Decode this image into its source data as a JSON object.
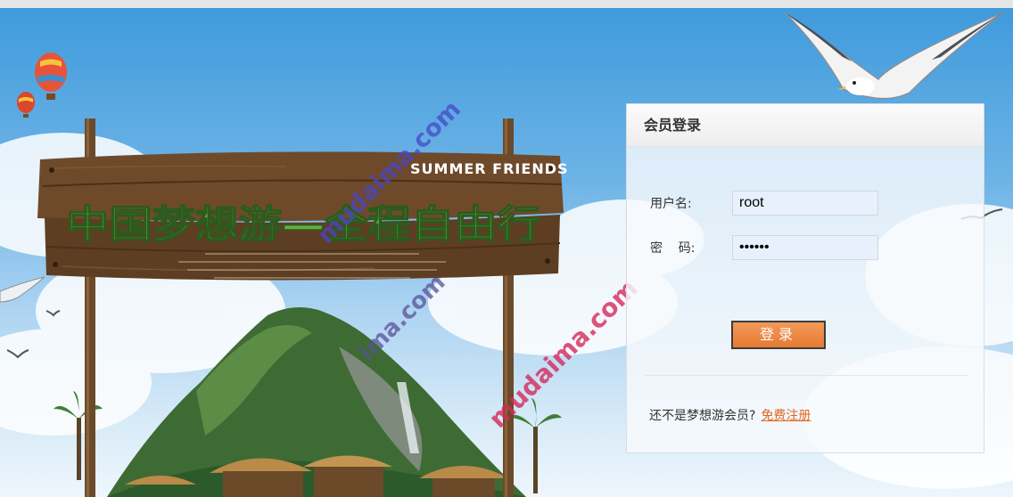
{
  "banner": {
    "title": "中国梦想游—全程自由行",
    "subtitle": "SUMMER FRIENDS"
  },
  "watermark": {
    "text": "mudaima.com",
    "partial_text": "ima.com"
  },
  "login": {
    "title": "会员登录",
    "username_label": "用户名:",
    "username_value": "root",
    "password_label": "密    码:",
    "password_value": "••••••",
    "submit_label": "登录",
    "register_prompt": "还不是梦想游会员?",
    "register_link": "免费注册"
  },
  "colors": {
    "accent": "#e67a32",
    "link": "#e2661f",
    "sky": "#6db3e6",
    "input_bg": "#e8f0fe"
  }
}
